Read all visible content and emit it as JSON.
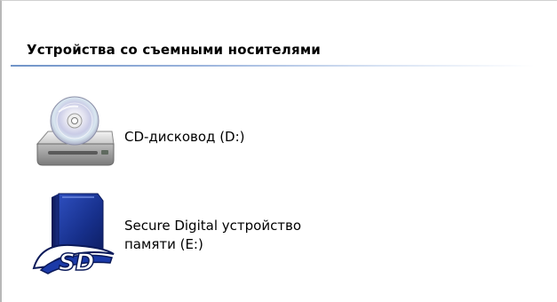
{
  "group": {
    "title": "Устройства со съемными носителями"
  },
  "drives": [
    {
      "label": "CD-дисковод (D:)",
      "icon": "cd-drive-icon"
    },
    {
      "label_line1": "Secure Digital устройство",
      "label_line2": "памяти (E:)",
      "icon": "sd-card-icon"
    }
  ]
}
